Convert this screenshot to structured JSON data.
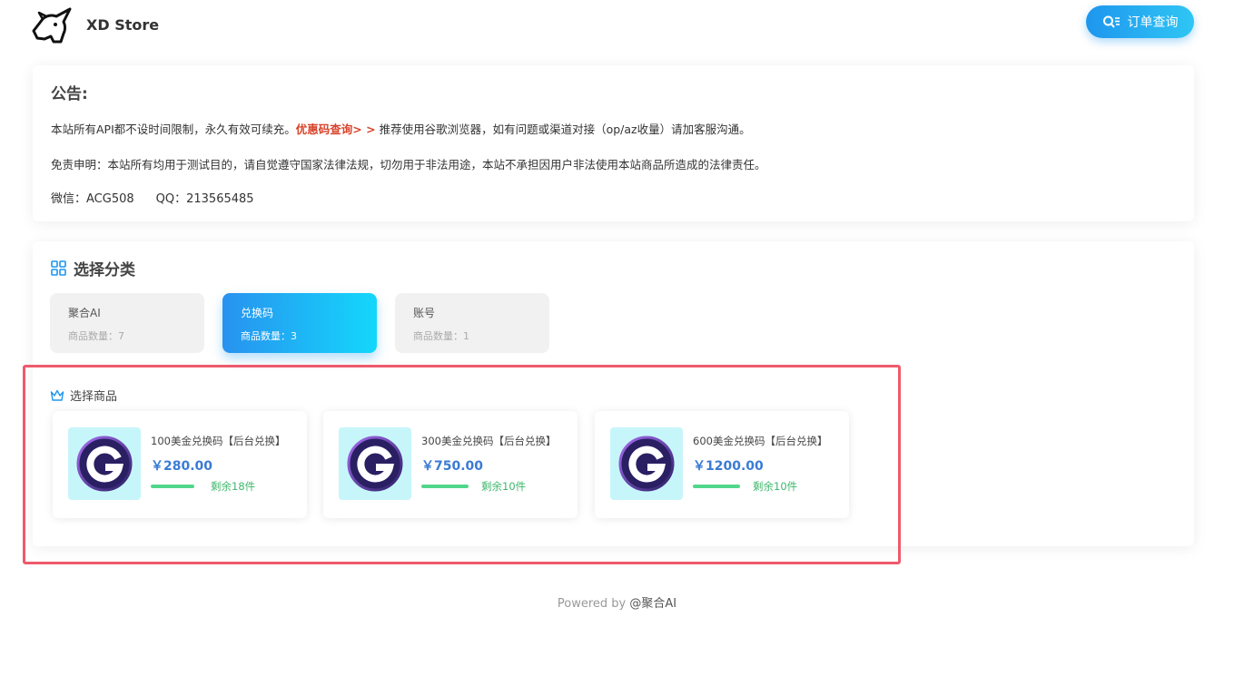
{
  "header": {
    "brand": "XD Store",
    "order_button": "订单查询"
  },
  "notice": {
    "title": "公告:",
    "line1_prefix": "本站所有API都不设时间限制，永久有效可续充。",
    "line1_link": "优惠码查询> >",
    "line1_suffix": " 推荐使用谷歌浏览器，如有问题或渠道对接（op/az收量）请加客服沟通。",
    "line2": "免责申明：本站所有均用于测试目的，请自觉遵守国家法律法规，切勿用于非法用途，本站不承担因用户非法使用本站商品所造成的法律责任。",
    "wechat": "微信：ACG508",
    "qq": "QQ：213565485"
  },
  "category": {
    "title": "选择分类",
    "items": [
      {
        "name": "聚合AI",
        "count": "商品数量：7",
        "active": false
      },
      {
        "name": "兑换码",
        "count": "商品数量：3",
        "active": true
      },
      {
        "name": "账号",
        "count": "商品数量：1",
        "active": false
      }
    ]
  },
  "products": {
    "title": "选择商品",
    "items": [
      {
        "name": "100美金兑换码【后台兑换】",
        "price": "￥280.00",
        "stock": "剩余18件"
      },
      {
        "name": "300美金兑换码【后台兑换】",
        "price": "￥750.00",
        "stock": "剩余10件"
      },
      {
        "name": "600美金兑换码【后台兑换】",
        "price": "￥1200.00",
        "stock": "剩余10件"
      }
    ]
  },
  "footer": {
    "powered": "Powered by ",
    "brand": "@聚合AI"
  },
  "colors": {
    "accent": "#1e96ee",
    "promo": "#d9432b",
    "price": "#3a7bd5",
    "stock": "#52d68b",
    "highlight": "#ee5a6c"
  }
}
